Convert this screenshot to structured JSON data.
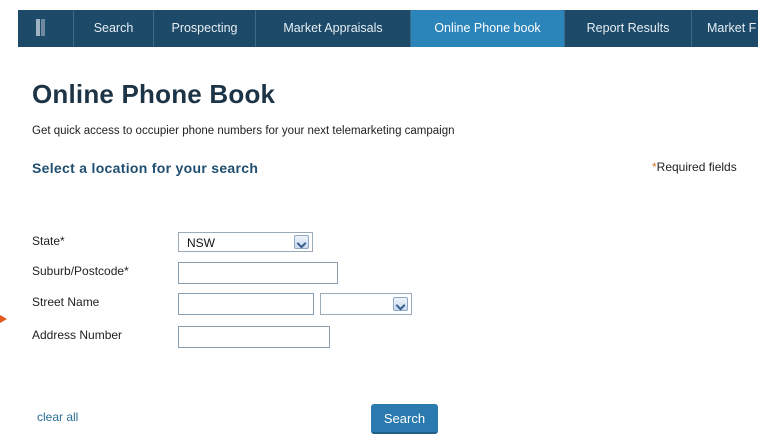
{
  "nav": {
    "items": [
      {
        "label": "Search"
      },
      {
        "label": "Prospecting"
      },
      {
        "label": "Market Appraisals"
      },
      {
        "label": "Online Phone book"
      },
      {
        "label": "Report Results"
      },
      {
        "label": "Market F"
      }
    ],
    "active_index": 3
  },
  "page": {
    "title": "Online Phone Book",
    "subtitle": "Get quick access to occupier phone numbers for your next telemarketing campaign",
    "section_heading": "Select a location for your search",
    "required_asterisk": "*",
    "required_text": "Required fields"
  },
  "form": {
    "state_label": "State*",
    "state_value": "NSW",
    "suburb_label": "Suburb/Postcode*",
    "suburb_value": "",
    "street_label": "Street Name",
    "street_value": "",
    "street_type_value": "",
    "address_label": "Address Number",
    "address_value": ""
  },
  "actions": {
    "clear_label": "clear all",
    "search_label": "Search"
  },
  "colors": {
    "nav_bg": "#1c4a68",
    "nav_active": "#2b84ba",
    "title": "#1d3446",
    "heading": "#1f4e70",
    "link": "#2a6f98",
    "button": "#2a7ab0",
    "asterisk": "#d77a29"
  }
}
